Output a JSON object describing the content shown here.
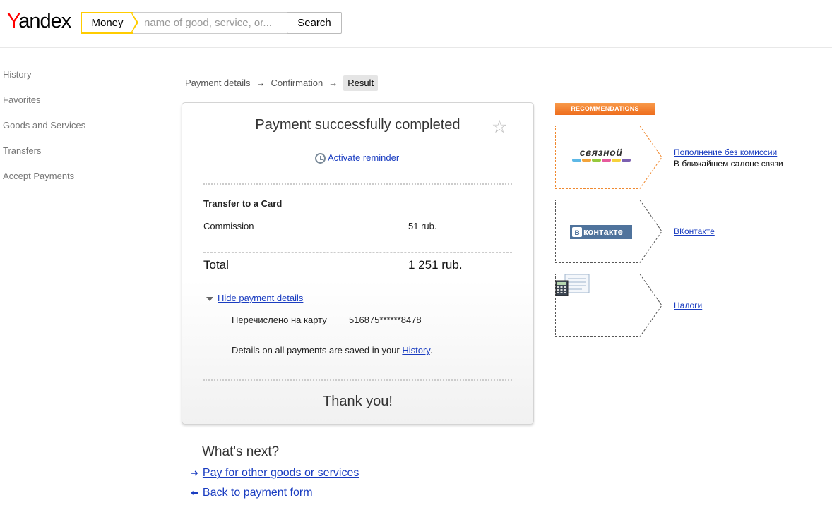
{
  "header": {
    "logo_y": "Y",
    "logo_rest": "andex",
    "service_label": "Money",
    "search_placeholder": "name of good, service, or...",
    "search_button": "Search"
  },
  "sidebar": {
    "items": [
      {
        "label": "History"
      },
      {
        "label": "Favorites"
      },
      {
        "label": "Goods and Services"
      },
      {
        "label": "Transfers"
      },
      {
        "label": "Accept Payments"
      }
    ]
  },
  "breadcrumb": {
    "steps": [
      "Payment details",
      "Confirmation",
      "Result"
    ],
    "arrow": "→"
  },
  "card": {
    "title": "Payment successfully completed",
    "reminder_link": "Activate reminder",
    "section_title": "Transfer to a Card",
    "commission_label": "Commission",
    "commission_value": "51 rub.",
    "total_label": "Total",
    "total_value": "1 251 rub.",
    "hide_details_link": "Hide payment details",
    "transferred_label": "Перечислено на карту",
    "transferred_value": "516875******8478",
    "history_note_before": "Details on all payments are saved in your ",
    "history_link": "History",
    "history_note_after": ".",
    "thanks": "Thank you!"
  },
  "next": {
    "title": "What's next?",
    "links": [
      {
        "label": "Pay for other goods or services",
        "arrow": "➜"
      },
      {
        "label": "Back to payment form",
        "arrow": "⬅"
      }
    ]
  },
  "recommendations": {
    "header": "RECOMMENDATIONS",
    "items": [
      {
        "logo": "связной",
        "link": "Пополнение без комиссии",
        "subtext": "В ближайшем салоне связи",
        "border_color": "#f0882e"
      },
      {
        "logo": "контакте",
        "logo_letter": "в",
        "link": "ВКонтакте",
        "border_color": "#555555"
      },
      {
        "logo": "tax-calculator-icon",
        "link": "Налоги",
        "border_color": "#555555"
      }
    ]
  },
  "colors": {
    "link": "#1a3dc1",
    "accent_yellow": "#ffcc00",
    "recommendation_orange": "#f07a2a",
    "vk_blue": "#4f739c"
  }
}
